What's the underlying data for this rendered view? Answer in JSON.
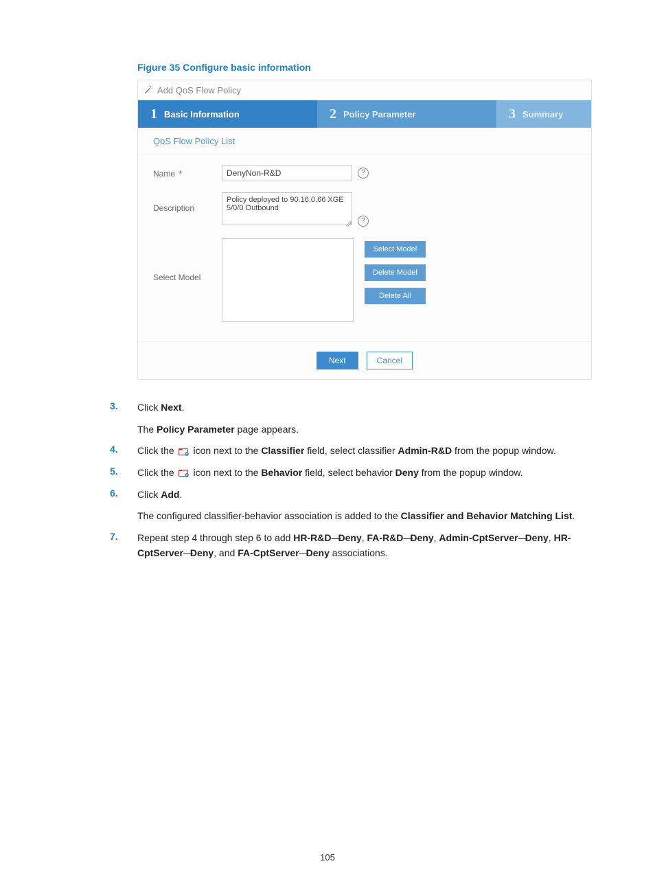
{
  "figure": {
    "caption": "Figure 35 Configure basic information"
  },
  "app": {
    "title": "Add QoS Flow Policy",
    "steps": {
      "s1_num": "1",
      "s1_label": "Basic Information",
      "s2_num": "2",
      "s2_label": "Policy Parameter",
      "s3_num": "3",
      "s3_label": "Summary"
    },
    "panel_header": "QoS Flow Policy List",
    "labels": {
      "name": "Name",
      "required_mark": "*",
      "description": "Description",
      "select_model": "Select Model"
    },
    "values": {
      "name": "DenyNon-R&D",
      "description": "Policy deployed to 90.16.0.66 XGE 5/0/0 Outbound"
    },
    "buttons": {
      "select_model": "Select Model",
      "delete_model": "Delete Model",
      "delete_all": "Delete All",
      "next": "Next",
      "cancel": "Cancel"
    }
  },
  "instructions": {
    "i3_num": "3.",
    "i3_a": "Click ",
    "i3_b": "Next",
    "i3_c": ".",
    "i3_sub_a": "The ",
    "i3_sub_b": "Policy Parameter",
    "i3_sub_c": " page appears.",
    "i4_num": "4.",
    "i4_a": "Click the ",
    "i4_b": " icon next to the ",
    "i4_c": "Classifier",
    "i4_d": " field, select classifier ",
    "i4_e": "Admin-R&D",
    "i4_f": " from the popup window.",
    "i5_num": "5.",
    "i5_a": "Click the ",
    "i5_b": " icon next to the ",
    "i5_c": "Behavior",
    "i5_d": " field, select behavior ",
    "i5_e": "Deny",
    "i5_f": " from the popup window.",
    "i6_num": "6.",
    "i6_a": "Click ",
    "i6_b": "Add",
    "i6_c": ".",
    "i6_sub_a": "The configured classifier-behavior association is added to the ",
    "i6_sub_b": "Classifier and Behavior Matching List",
    "i6_sub_c": ".",
    "i7_num": "7.",
    "i7_a": "Repeat step 4 through step 6 to add ",
    "i7_p1a": "HR-R&D",
    "i7_p1b": "Deny",
    "i7_sep": ", ",
    "i7_p2a": "FA-R&D",
    "i7_p2b": "Deny",
    "i7_p3a": "Admin-CptServer",
    "i7_p3b": "Deny",
    "i7_p4a": "HR-CptServer",
    "i7_p4b": "Deny",
    "i7_and": ", and ",
    "i7_p5a": "FA-CptServer",
    "i7_p5b": "Deny",
    "i7_end": " associations.",
    "dash": "—"
  },
  "page_number": "105"
}
